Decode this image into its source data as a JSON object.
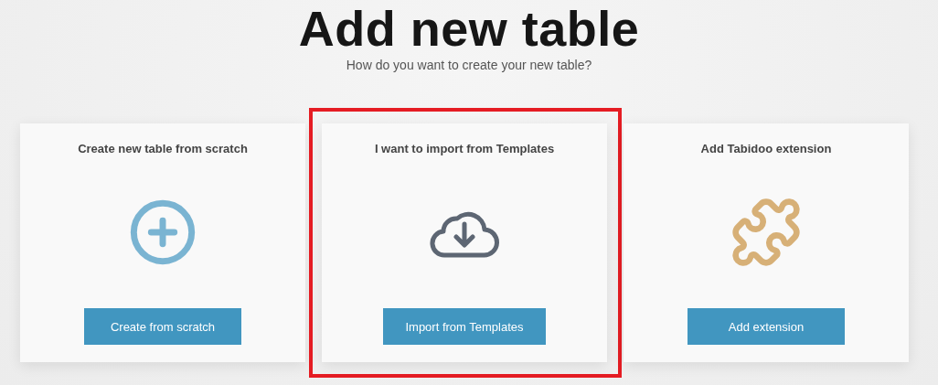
{
  "title": "Add new table",
  "subtitle": "How do you want to create your new table?",
  "cards": [
    {
      "heading": "Create new table from scratch",
      "kind": "plus-circle",
      "color": "#7ab4d2",
      "button": "Create from scratch",
      "highlighted": false
    },
    {
      "heading": "I want to import from Templates",
      "kind": "cloud-download",
      "color": "#5d6673",
      "button": "Import from Templates",
      "highlighted": true
    },
    {
      "heading": "Add Tabidoo extension",
      "kind": "puzzle",
      "color": "#d7b077",
      "button": "Add extension",
      "highlighted": false
    }
  ]
}
